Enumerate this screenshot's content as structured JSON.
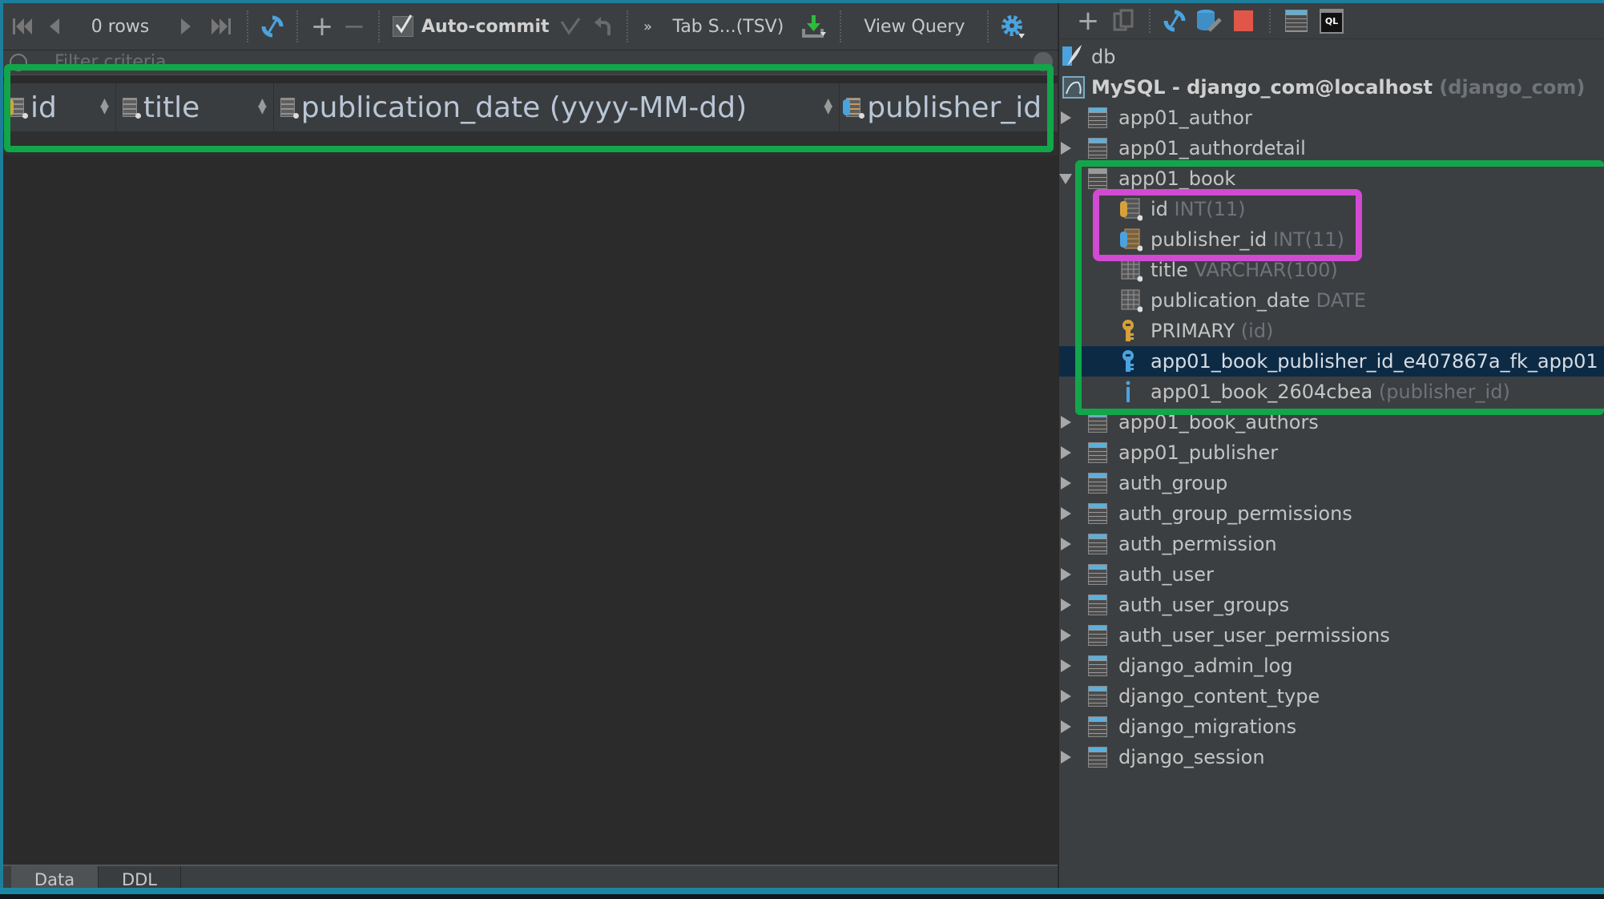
{
  "toolbar": {
    "rows_label": "0 rows",
    "autocommit_label": "Auto-commit",
    "autocommit_checked": true,
    "format_label": "Tab S...(TSV)",
    "view_query_label": "View Query",
    "more_label": "»"
  },
  "filter": {
    "placeholder": "Filter criteria"
  },
  "columns": [
    {
      "name": "id",
      "icon": "primary-key-column-icon"
    },
    {
      "name": "title",
      "icon": "column-icon"
    },
    {
      "name": "publication_date (yyyy-MM-dd)",
      "icon": "column-icon"
    },
    {
      "name": "publisher_id",
      "icon": "foreign-key-column-icon"
    }
  ],
  "bottom_tabs": [
    {
      "label": "Data",
      "active": true
    },
    {
      "label": "DDL",
      "active": false
    }
  ],
  "tree": {
    "root": "db",
    "connection": {
      "name": "MySQL - django_com@localhost",
      "schema": "(django_com)"
    },
    "tables_before": [
      "app01_author",
      "app01_authordetail"
    ],
    "expanded_table": {
      "name": "app01_book",
      "children": [
        {
          "name": "id",
          "type": "INT(11)",
          "kind": "pk-column"
        },
        {
          "name": "publisher_id",
          "type": "INT(11)",
          "kind": "fk-column"
        },
        {
          "name": "title",
          "type": "VARCHAR(100)",
          "kind": "column"
        },
        {
          "name": "publication_date",
          "type": "DATE",
          "kind": "column"
        },
        {
          "name": "PRIMARY",
          "type": "(id)",
          "kind": "primary-key"
        },
        {
          "name": "app01_book_publisher_id_e407867a_fk_app01",
          "type": "",
          "kind": "foreign-key",
          "selected": true
        },
        {
          "name": "app01_book_2604cbea",
          "type": "(publisher_id)",
          "kind": "index"
        }
      ]
    },
    "tables_after": [
      "app01_book_authors",
      "app01_publisher",
      "auth_group",
      "auth_group_permissions",
      "auth_permission",
      "auth_user",
      "auth_user_groups",
      "auth_user_user_permissions",
      "django_admin_log",
      "django_content_type",
      "django_migrations",
      "django_session"
    ]
  },
  "colors": {
    "highlight_green": "#12a64a",
    "highlight_pink": "#d24ad3",
    "selection": "#0d2a45",
    "accent_blue": "#4aa3df"
  }
}
